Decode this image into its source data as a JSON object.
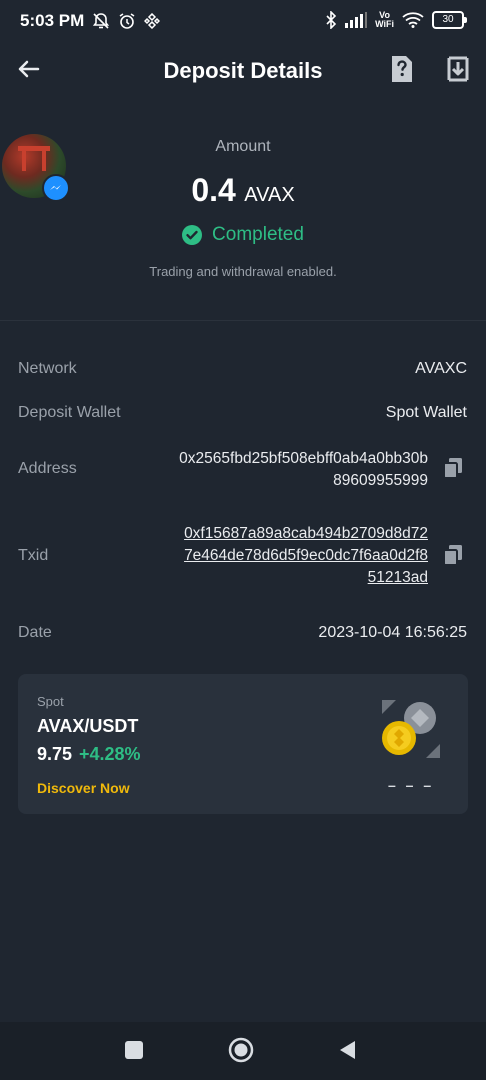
{
  "status_bar": {
    "time": "5:03 PM",
    "vowifi_top": "Vo",
    "vowifi_bottom": "WiFi",
    "battery": "30"
  },
  "header": {
    "title": "Deposit Details"
  },
  "summary": {
    "amount_label": "Amount",
    "amount_value": "0.4",
    "amount_unit": "AVAX",
    "status": "Completed",
    "note": "Trading and withdrawal enabled."
  },
  "details": {
    "network_label": "Network",
    "network_value": "AVAXC",
    "wallet_label": "Deposit Wallet",
    "wallet_value": "Spot Wallet",
    "address_label": "Address",
    "address_value": "0x2565fbd25bf508ebff0ab4a0bb30b89609955999",
    "txid_label": "Txid",
    "txid_value": "0xf15687a89a8cab494b2709d8d727e464de78d6d5f9ec0dc7f6aa0d2f851213ad",
    "date_label": "Date",
    "date_value": "2023-10-04 16:56:25"
  },
  "promo_card": {
    "tag": "Spot",
    "pair": "AVAX/USDT",
    "price": "9.75",
    "change": "+4.28%",
    "link": "Discover Now",
    "dashes": "– – –"
  },
  "colors": {
    "background": "#1f2630",
    "card": "#29313c",
    "positive": "#2ebd85",
    "accent": "#f0b90b"
  },
  "icons": {
    "back": "arrow-left-icon",
    "help": "help-document-icon",
    "download": "download-icon",
    "status": "check-circle-icon",
    "copy": "copy-icon"
  }
}
